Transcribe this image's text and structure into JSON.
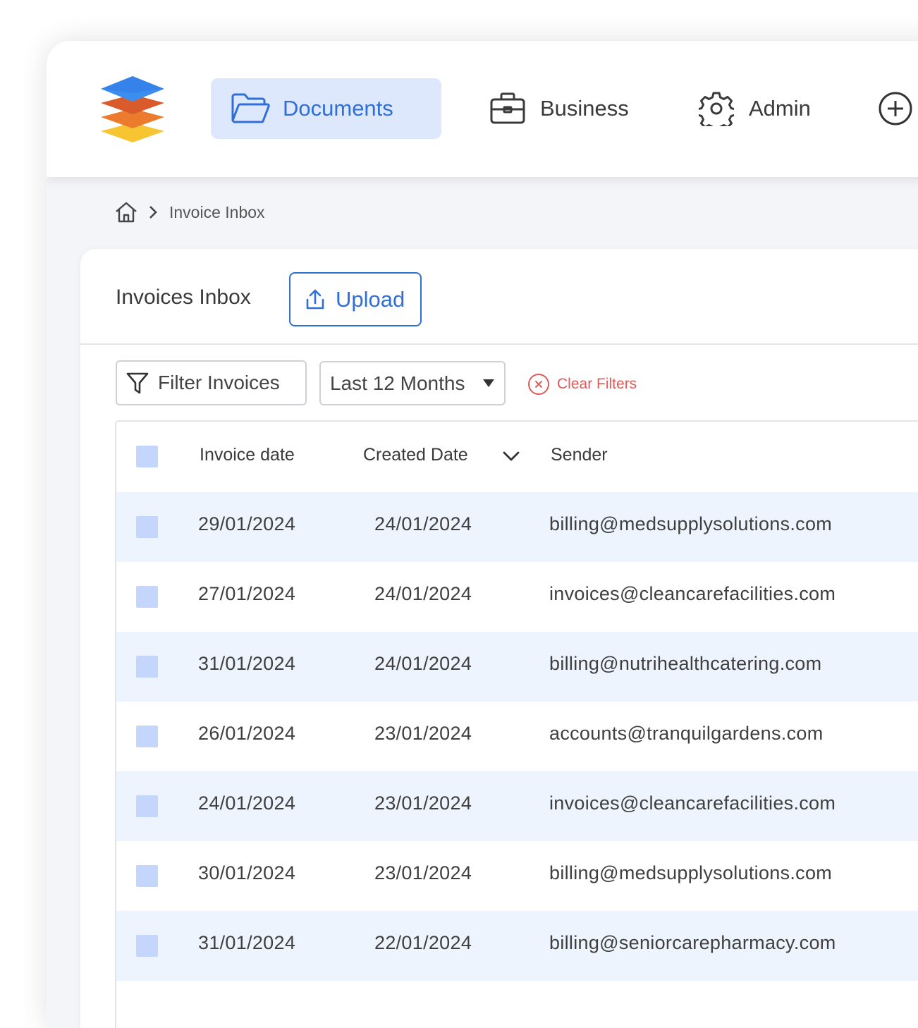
{
  "nav": {
    "items": [
      {
        "label": "Documents",
        "icon": "folder-icon",
        "active": true
      },
      {
        "label": "Business",
        "icon": "briefcase-icon",
        "active": false
      },
      {
        "label": "Admin",
        "icon": "gear-icon",
        "active": false
      }
    ],
    "add_icon": "plus-circle-icon"
  },
  "breadcrumb": {
    "home_icon": "home-icon",
    "current": "Invoice Inbox"
  },
  "card": {
    "title": "Invoices Inbox",
    "upload_label": "Upload"
  },
  "filters": {
    "filter_placeholder": "Filter Invoices",
    "period": "Last 12 Months",
    "clear_label": "Clear Filters"
  },
  "table": {
    "columns": [
      "Invoice date",
      "Created Date",
      "Sender"
    ],
    "sort_icon": "chevron-down-icon",
    "rows": [
      {
        "invoice_date": "29/01/2024",
        "created_date": "24/01/2024",
        "sender": "billing@medsupplysolutions.com"
      },
      {
        "invoice_date": "27/01/2024",
        "created_date": "24/01/2024",
        "sender": "invoices@cleancarefacilities.com"
      },
      {
        "invoice_date": "31/01/2024",
        "created_date": "24/01/2024",
        "sender": "billing@nutrihealthcatering.com"
      },
      {
        "invoice_date": "26/01/2024",
        "created_date": "23/01/2024",
        "sender": "accounts@tranquilgardens.com"
      },
      {
        "invoice_date": "24/01/2024",
        "created_date": "23/01/2024",
        "sender": "invoices@cleancarefacilities.com"
      },
      {
        "invoice_date": "30/01/2024",
        "created_date": "23/01/2024",
        "sender": "billing@medsupplysolutions.com"
      },
      {
        "invoice_date": "31/01/2024",
        "created_date": "22/01/2024",
        "sender": "billing@seniorcarepharmacy.com"
      }
    ]
  },
  "colors": {
    "accent": "#2f6fd6",
    "accent_bg": "#dde8fc",
    "row_alt": "#eef4fe",
    "checkbox": "#c4d6fb",
    "danger": "#e05a5a"
  }
}
